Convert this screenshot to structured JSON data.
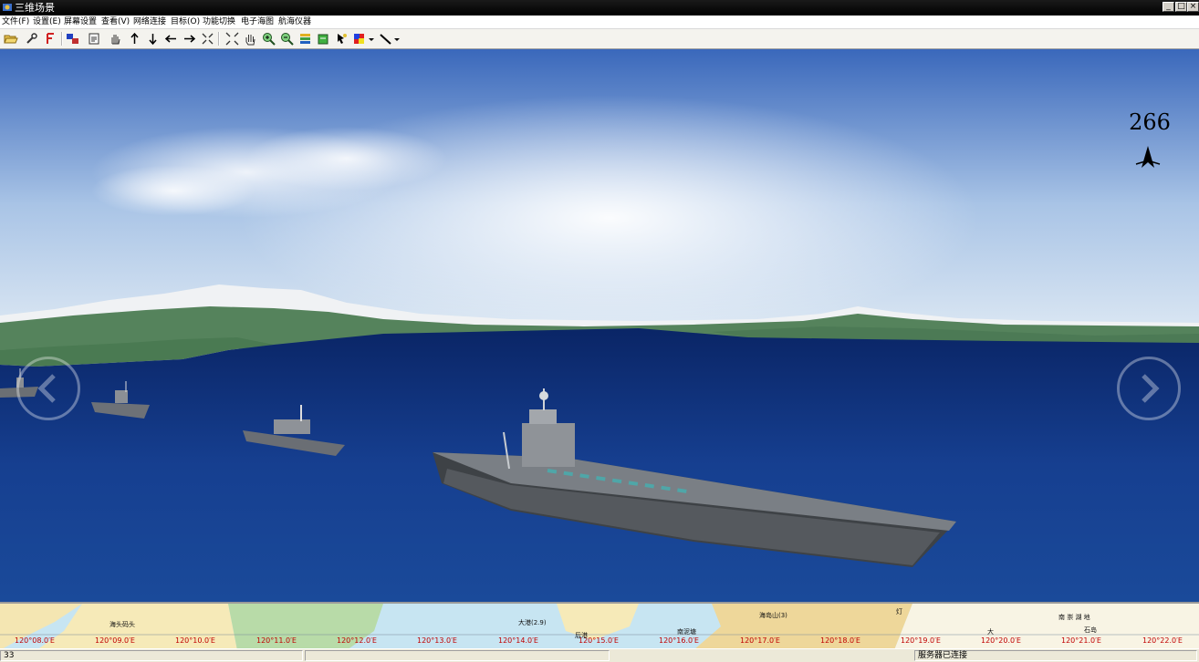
{
  "window": {
    "title": "三维场景",
    "controls": [
      "minimize-icon",
      "maximize-icon",
      "close-icon"
    ]
  },
  "menu": {
    "items": [
      "文件(F)",
      "设置(E)",
      "屏幕设置",
      "查看(V)",
      "网络连接",
      "目标(O)",
      "功能切换",
      "电子海图",
      "航海仪器"
    ]
  },
  "toolbar": {
    "icons": [
      "open-folder-icon",
      "wrench-icon",
      "font-f-icon",
      "screens-icon",
      "save-icon",
      "hand-pan-icon",
      "arrow-up-icon",
      "arrow-down-icon",
      "arrow-left-icon",
      "arrow-right-icon",
      "collapse-icon",
      "expand-icon",
      "hand-grab-icon",
      "zoom-in-icon",
      "zoom-out-icon",
      "layers-icon",
      "green-box-icon",
      "cursor-target-icon",
      "color-palette-icon",
      "ruler-line-icon"
    ]
  },
  "viewport": {
    "heading": "266",
    "compass_icon": "north-arrow-icon",
    "prev_icon": "chevron-left-icon",
    "next_icon": "chevron-right-icon"
  },
  "chart_strip": {
    "longitudes": [
      "120°08.0′E",
      "120°09.0′E",
      "120°10.0′E",
      "120°11.0′E",
      "120°12.0′E",
      "120°13.0′E",
      "120°14.0′E",
      "120°15.0′E",
      "120°16.0′E",
      "120°17.0′E",
      "120°18.0′E",
      "120°19.0′E",
      "120°20.0′E",
      "120°21.0′E",
      "120°22.0′E"
    ],
    "places": [
      "海头码头",
      "大港(2.9)",
      "后港",
      "海岛山(3)",
      "南泥塘",
      "灯",
      "大",
      "南 崇 湖 地",
      "石岛"
    ]
  },
  "status": {
    "left": "33",
    "middle": "",
    "right": "服务器已连接"
  },
  "colors": {
    "sea": "#0e2f7a",
    "sky_top": "#3f6fc0",
    "land": "#4f7a55",
    "snow": "#f2f4f6",
    "chart_sea": "#bfe0f0",
    "chart_land": "#f3e4ae",
    "lon_label": "#c00000"
  }
}
